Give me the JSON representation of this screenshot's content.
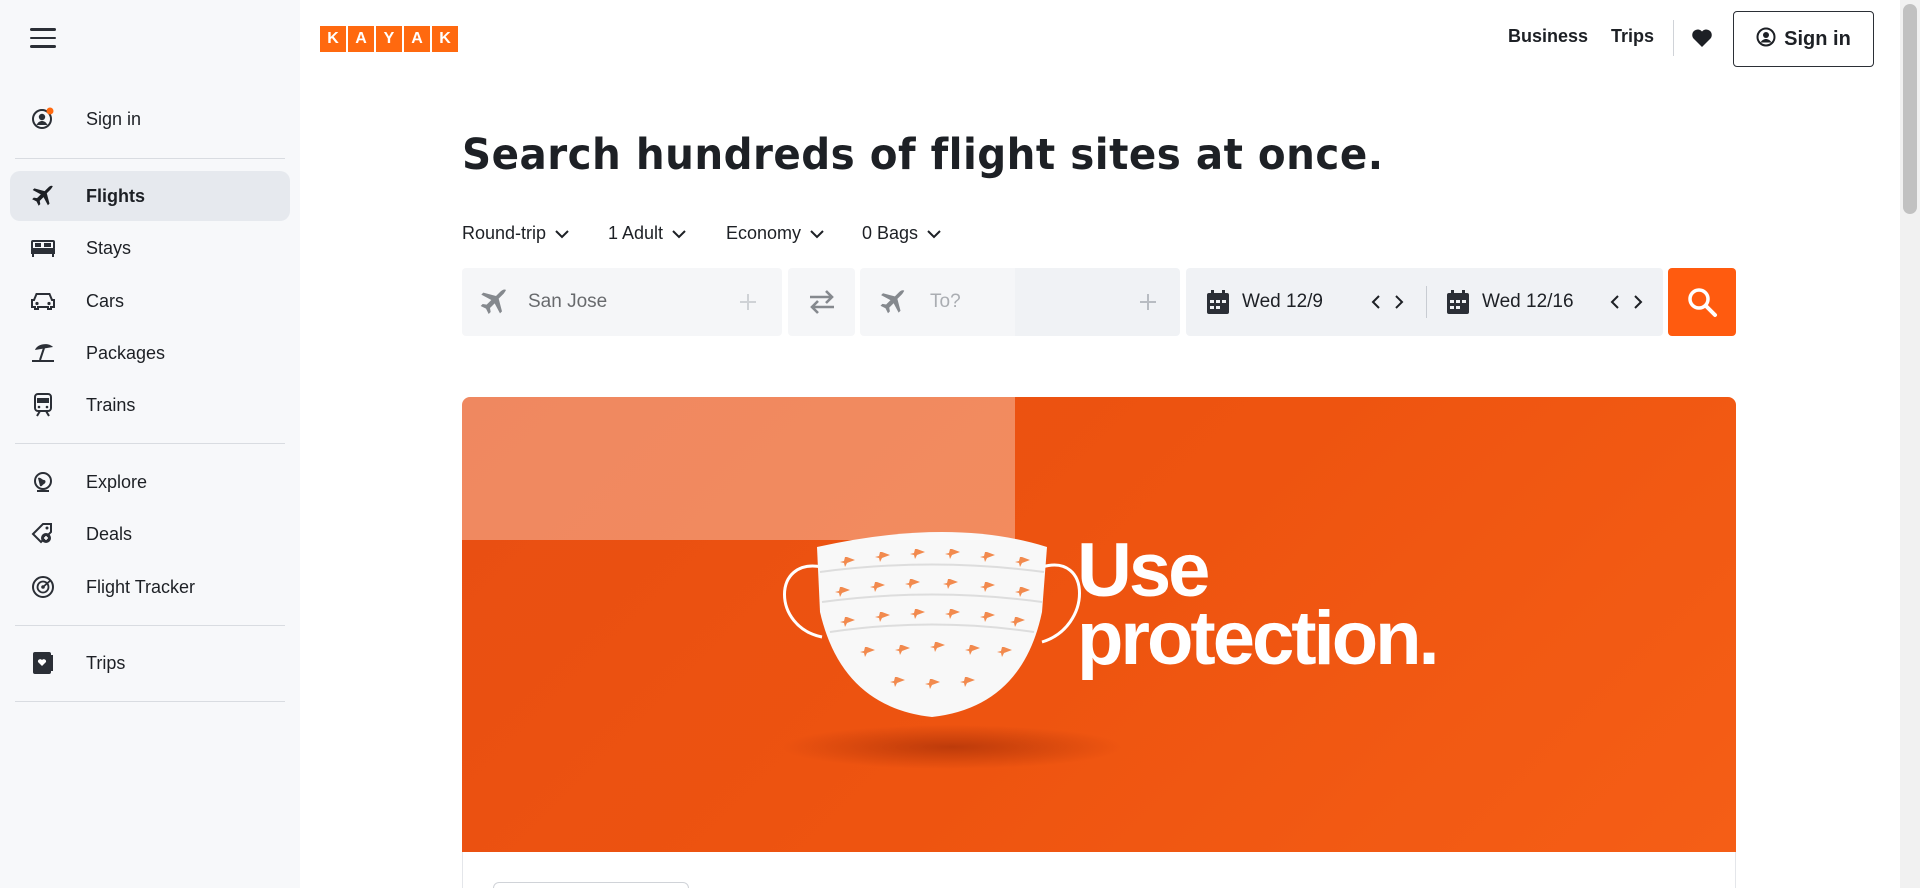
{
  "sidebar": {
    "items": [
      {
        "label": "Sign in",
        "icon": "user-icon"
      },
      {
        "label": "Flights",
        "icon": "plane-icon",
        "active": true
      },
      {
        "label": "Stays",
        "icon": "bed-icon"
      },
      {
        "label": "Cars",
        "icon": "car-icon"
      },
      {
        "label": "Packages",
        "icon": "umbrella-icon"
      },
      {
        "label": "Trains",
        "icon": "train-icon"
      },
      {
        "label": "Explore",
        "icon": "globe-icon"
      },
      {
        "label": "Deals",
        "icon": "tag-icon"
      },
      {
        "label": "Flight Tracker",
        "icon": "radar-icon"
      },
      {
        "label": "Trips",
        "icon": "trips-icon"
      }
    ]
  },
  "header": {
    "logo_letters": [
      "K",
      "A",
      "Y",
      "A",
      "K"
    ],
    "nav_business": "Business",
    "nav_trips": "Trips",
    "signin_label": "Sign in"
  },
  "search": {
    "headline": "Search hundreds of flight sites at once.",
    "trip_type": "Round-trip",
    "travelers": "1 Adult",
    "cabin": "Economy",
    "bags": "0 Bags",
    "origin_value": "San Jose",
    "destination_placeholder": "To?",
    "depart_date": "Wed 12/9",
    "return_date": "Wed 12/16"
  },
  "banner": {
    "line1": "Use",
    "line2": "protection."
  },
  "colors": {
    "accent": "#ff690f",
    "banner": "#ee5410",
    "sidebar_bg": "#f7f8fa"
  }
}
